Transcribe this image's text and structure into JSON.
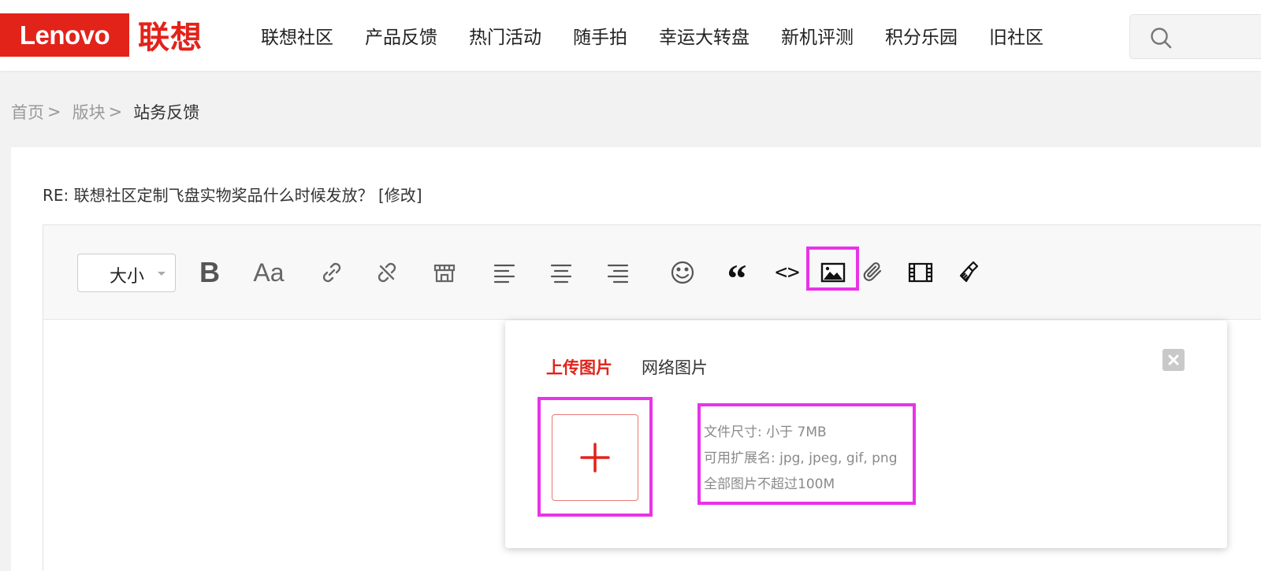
{
  "header": {
    "logo_text": "Lenovo",
    "logo_cn": "联想",
    "nav": [
      "联想社区",
      "产品反馈",
      "热门活动",
      "随手拍",
      "幸运大转盘",
      "新机评测",
      "积分乐园",
      "旧社区"
    ],
    "search_icon": "search-icon",
    "accent_color": "#e2231a"
  },
  "breadcrumb": {
    "items": [
      "首页",
      "版块"
    ],
    "separator": ">",
    "current": "站务反馈"
  },
  "post": {
    "title": "RE: 联想社区定制飞盘实物奖品什么时候发放？ [修改]"
  },
  "toolbar": {
    "size_label": "大小",
    "bold_label": "B",
    "font_label": "Aa",
    "quote_label": "“",
    "code_label": "<>",
    "icons": [
      "link-icon",
      "unlink-icon",
      "store-icon",
      "align-left-icon",
      "align-center-icon",
      "align-right-icon",
      "emoji-icon",
      "quote-icon",
      "code-icon",
      "image-icon",
      "attachment-icon",
      "video-icon",
      "clear-format-icon"
    ]
  },
  "image_popup": {
    "tab_upload": "上传图片",
    "tab_web": "网络图片",
    "info_lines": [
      "文件尺寸: 小于 7MB",
      "可用扩展名: jpg, jpeg, gif, png",
      "全部图片不超过100M"
    ],
    "highlight_color": "#e833e8"
  }
}
